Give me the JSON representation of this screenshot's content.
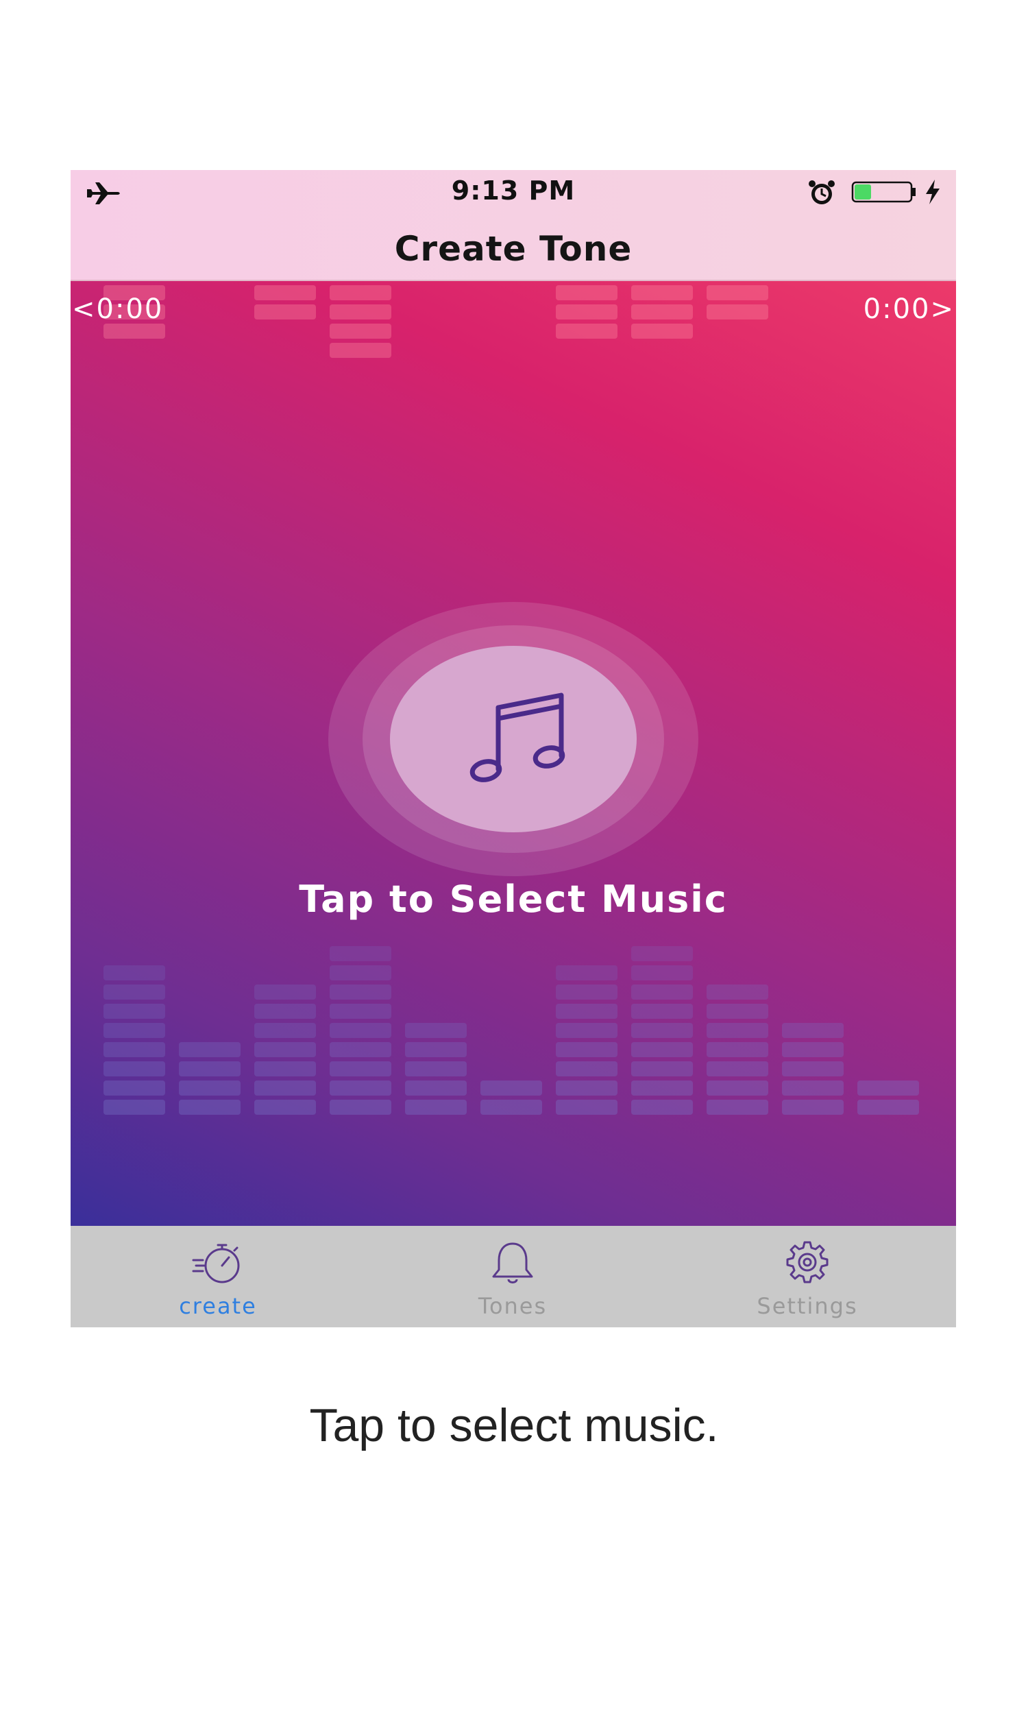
{
  "status_bar": {
    "time": "9:13 PM",
    "icons": [
      "airplane-icon",
      "alarm-icon",
      "battery-icon",
      "charging-bolt-icon"
    ],
    "battery_level": 0.3,
    "battery_fill_color": "#4cd964"
  },
  "nav": {
    "title": "Create Tone"
  },
  "player": {
    "start_time": "<0:00",
    "end_time": "0:00>",
    "prompt": "Tap to Select Music",
    "icon": "music-note-icon",
    "note_color": "#4a2a8a"
  },
  "tab_bar": {
    "active_color": "#2f7fe0",
    "inactive_color": "#9a9a9a",
    "tabs": [
      {
        "label": "create",
        "icon": "stopwatch-icon",
        "active": true
      },
      {
        "label": "Tones",
        "icon": "bell-icon",
        "active": false
      },
      {
        "label": "Settings",
        "icon": "gear-icon",
        "active": false
      }
    ]
  },
  "caption": "Tap to select music."
}
